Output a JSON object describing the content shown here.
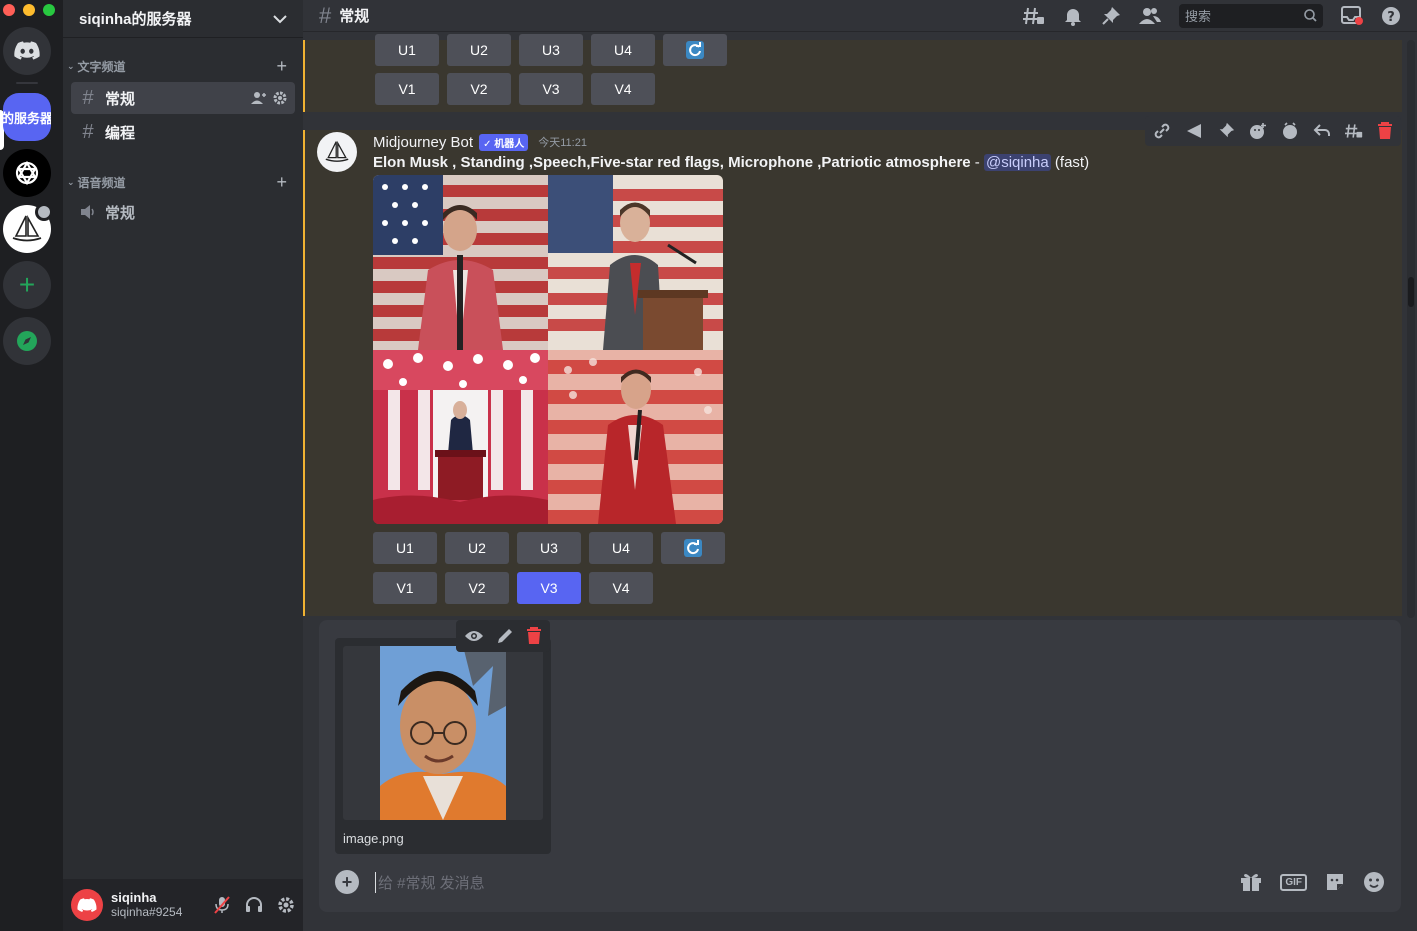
{
  "server": {
    "name": "siqinha的服务器",
    "active_short": "的服务器"
  },
  "sidebar": {
    "text_category": "文字频道",
    "voice_category": "语音频道",
    "text_channels": [
      {
        "label": "常规"
      },
      {
        "label": "编程"
      }
    ],
    "voice_channels": [
      {
        "label": "常规"
      }
    ]
  },
  "user": {
    "name": "siqinha",
    "tag": "siqinha#9254"
  },
  "topbar": {
    "channel": "常规",
    "search_placeholder": "搜索"
  },
  "buttons": {
    "upscale": [
      "U1",
      "U2",
      "U3",
      "U4"
    ],
    "variation": [
      "V1",
      "V2",
      "V3",
      "V4"
    ],
    "selected_variation": "V3"
  },
  "message": {
    "author": "Midjourney Bot",
    "bot_tag": "✓ 机器人",
    "time": "今天11:21",
    "prompt": "Elon Musk , Standing ,Speech,Five-star red flags, Microphone ,Patriotic atmosphere",
    "separator": " - ",
    "mention": "@siqinha",
    "mode": "(fast)"
  },
  "attachment": {
    "filename": "image.png"
  },
  "composer": {
    "placeholder": "给 #常规 发消息"
  },
  "colors": {
    "blurple": "#5865f2",
    "danger": "#ed4245",
    "highlight_bar": "#f0b232",
    "green": "#23a55a"
  }
}
